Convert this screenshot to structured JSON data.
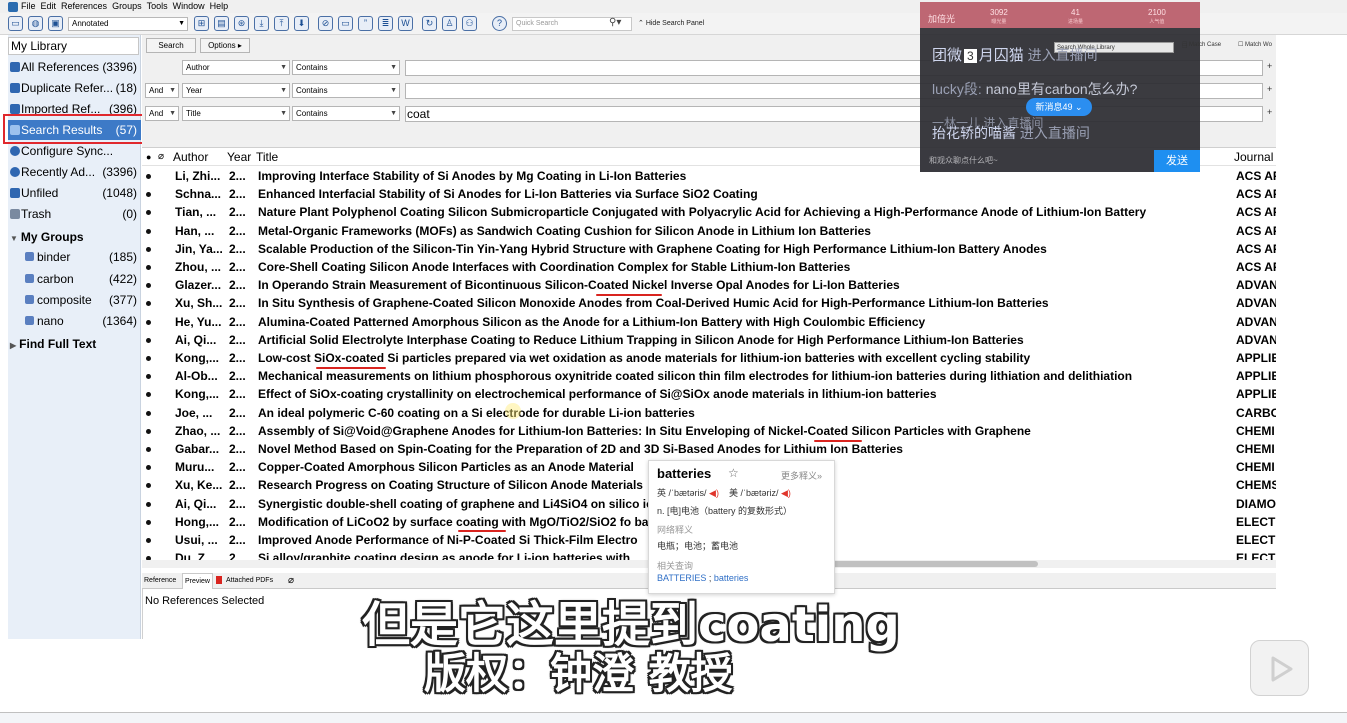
{
  "menu": [
    "File",
    "Edit",
    "References",
    "Groups",
    "Tools",
    "Window",
    "Help"
  ],
  "toolbar": {
    "style": "Annotated",
    "quick_search_placeholder": "Quick Search",
    "hide_search_label": "Hide Search Panel"
  },
  "library_label": "My Library",
  "groups": [
    {
      "label": "All References",
      "count": "(3396)"
    },
    {
      "label": "Duplicate Refer...",
      "count": "(18)"
    },
    {
      "label": "Imported Ref...",
      "count": "(396)"
    },
    {
      "label": "Search Results",
      "count": "(57)"
    },
    {
      "label": "Configure Sync...",
      "count": ""
    },
    {
      "label": "Recently Ad...",
      "count": "(3396)"
    },
    {
      "label": "Unfiled",
      "count": "(1048)"
    },
    {
      "label": "Trash",
      "count": "(0)"
    }
  ],
  "my_groups_header": "My Groups",
  "my_groups": [
    {
      "label": "binder",
      "count": "(185)"
    },
    {
      "label": "carbon",
      "count": "(422)"
    },
    {
      "label": "composite",
      "count": "(377)"
    },
    {
      "label": "nano",
      "count": "(1364)"
    }
  ],
  "find_full_text": "Find Full Text",
  "search": {
    "search_btn": "Search",
    "options_btn": "Options",
    "rows": [
      {
        "bool": "",
        "field": "Author",
        "op": "Contains",
        "value": ""
      },
      {
        "bool": "And",
        "field": "Year",
        "op": "Contains",
        "value": ""
      },
      {
        "bool": "And",
        "field": "Title",
        "op": "Contains",
        "value": "coat"
      }
    ]
  },
  "list_header": {
    "author": "Author",
    "year": "Year",
    "title": "Title",
    "journal": "Journal"
  },
  "references": [
    {
      "author": "Li, Zhi...",
      "year": "2...",
      "title": "Improving Interface Stability of Si Anodes by Mg Coating in Li-Ion Batteries",
      "journal": "ACS AP"
    },
    {
      "author": "Schna...",
      "year": "2...",
      "title": "Enhanced Interfacial Stability of Si Anodes for Li-Ion Batteries via Surface SiO2 Coating",
      "journal": "ACS AP"
    },
    {
      "author": "Tian, ...",
      "year": "2...",
      "title": "Nature Plant Polyphenol Coating Silicon Submicroparticle Conjugated with Polyacrylic Acid for Achieving a High-Performance Anode of Lithium-Ion Battery",
      "journal": "ACS AP"
    },
    {
      "author": "Han, ...",
      "year": "2...",
      "title": "Metal-Organic Frameworks (MOFs) as Sandwich Coating Cushion for Silicon Anode in Lithium Ion Batteries",
      "journal": "ACS AP"
    },
    {
      "author": "Jin, Ya...",
      "year": "2...",
      "title": "Scalable Production of the Silicon-Tin Yin-Yang Hybrid Structure with Graphene Coating for High Performance Lithium-Ion Battery Anodes",
      "journal": "ACS AP"
    },
    {
      "author": "Zhou, ...",
      "year": "2...",
      "title": "Core-Shell Coating Silicon Anode Interfaces with Coordination Complex for Stable Lithium-Ion Batteries",
      "journal": "ACS AP"
    },
    {
      "author": "Glazer...",
      "year": "2...",
      "title": "In Operando Strain Measurement of Bicontinuous Silicon-Coated Nickel Inverse Opal Anodes for Li-Ion Batteries",
      "journal": "ADVAN"
    },
    {
      "author": "Xu, Sh...",
      "year": "2...",
      "title": "In Situ Synthesis of Graphene-Coated Silicon Monoxide Anodes from Coal-Derived Humic Acid for High-Performance Lithium-Ion Batteries",
      "journal": "ADVAN"
    },
    {
      "author": "He, Yu...",
      "year": "2...",
      "title": "Alumina-Coated Patterned Amorphous Silicon as the Anode for a Lithium-Ion Battery with High Coulombic Efficiency",
      "journal": "ADVAN"
    },
    {
      "author": "Ai, Qi...",
      "year": "2...",
      "title": "Artificial Solid Electrolyte Interphase Coating to Reduce Lithium Trapping in Silicon Anode for High Performance Lithium-Ion Batteries",
      "journal": "ADVAN"
    },
    {
      "author": "Kong,...",
      "year": "2...",
      "title": "Low-cost SiOx-coated Si particles prepared via wet oxidation as anode materials for lithium-ion batteries with excellent cycling stability",
      "journal": "APPLIE"
    },
    {
      "author": "Al-Ob...",
      "year": "2...",
      "title": "Mechanical measurements on lithium phosphorous oxynitride coated silicon thin film electrodes for lithium-ion batteries during lithiation and delithiation",
      "journal": "APPLIE"
    },
    {
      "author": "Kong,...",
      "year": "2...",
      "title": "Effect of SiOx-coating crystallinity on electrochemical performance of Si@SiOx anode materials in lithium-ion batteries",
      "journal": "APPLIE"
    },
    {
      "author": "Joe, ...",
      "year": "2...",
      "title": "An ideal polymeric C-60 coating on a Si electrode for durable Li-ion batteries",
      "journal": "CARBO"
    },
    {
      "author": "Zhao, ...",
      "year": "2...",
      "title": "Assembly of Si@Void@Graphene Anodes for Lithium-Ion Batteries: In Situ Enveloping of Nickel-Coated Silicon Particles with Graphene",
      "journal": "CHEMI"
    },
    {
      "author": "Gabar...",
      "year": "2...",
      "title": "Novel Method Based on Spin-Coating for the Preparation of 2D and 3D Si-Based Anodes for Lithium Ion Batteries",
      "journal": "CHEMI"
    },
    {
      "author": "Muru...",
      "year": "2...",
      "title": "Copper-Coated Amorphous Silicon Particles as an Anode Material",
      "journal": "CHEMI"
    },
    {
      "author": "Xu, Ke...",
      "year": "2...",
      "title": "Research Progress on Coating Structure of Silicon Anode Materials",
      "journal": "CHEMS"
    },
    {
      "author": "Ai, Qi...",
      "year": "2...",
      "title": "Synergistic double-shell coating of graphene and Li4SiO4 on silico                                     ion battery application",
      "journal": "DIAMO"
    },
    {
      "author": "Hong,...",
      "year": "2...",
      "title": "Modification of LiCoO2 by surface coating with MgO/TiO2/SiO2 fo                                          battery",
      "journal": "ELECTR"
    },
    {
      "author": "Usui, ...",
      "year": "2...",
      "title": "Improved Anode Performance of Ni-P-Coated Si Thick-Film Electro",
      "journal": "ELECTR"
    },
    {
      "author": "Du, Z...",
      "year": "2...",
      "title": "Si alloy/graphite coating design as anode for Li-ion batteries with",
      "journal": "ELECTR"
    }
  ],
  "tabs": {
    "reference": "Reference",
    "preview": "Preview",
    "pdfs": "Attached PDFs"
  },
  "preview_text": "No References Selected",
  "live": {
    "stats": [
      {
        "label": "加倍光",
        "sub": ""
      },
      {
        "label": "3092",
        "sub": "曝光量"
      },
      {
        "label": "41",
        "sub": "进场量"
      },
      {
        "label": "2100",
        "sub": "人气值"
      }
    ],
    "search_box": "Search Whole Library",
    "match_case": "Match Case",
    "match_words": "Match Wo",
    "msg1_name": "团微",
    "msg1_badge": "3",
    "msg1_name2": "月囚猫",
    "msg1_text": "进入直播间",
    "msg2_name": "lucky段:",
    "msg2_text": "nano里有carbon怎么办?",
    "new_messages": "新消息49",
    "msg3_partial": "一林一儿  进入直播间",
    "msg4_name": "抬花轿的喵酱",
    "msg4_text": "进入直播间",
    "input_placeholder": "和观众聊点什么吧~",
    "send": "发送"
  },
  "dict": {
    "word": "batteries",
    "more": "更多释义»",
    "phon_uk": "英 /ˈbætəris/",
    "phon_us": "美 /ˈbætəriz/",
    "def": "n. [电]电池（battery 的复数形式）",
    "web_label": "网络释义",
    "web_def": "电瓶；电池；蓄电池",
    "related_label": "相关查询",
    "related1": "BATTERIES",
    "related2": "batteries"
  },
  "subtitle_line1": "但是它这里提到coating",
  "subtitle_line2": "版权：钟澄 教授",
  "colors": {
    "accent": "#3d7ac7",
    "highlight": "#e0282d",
    "send": "#1e8ff1"
  }
}
